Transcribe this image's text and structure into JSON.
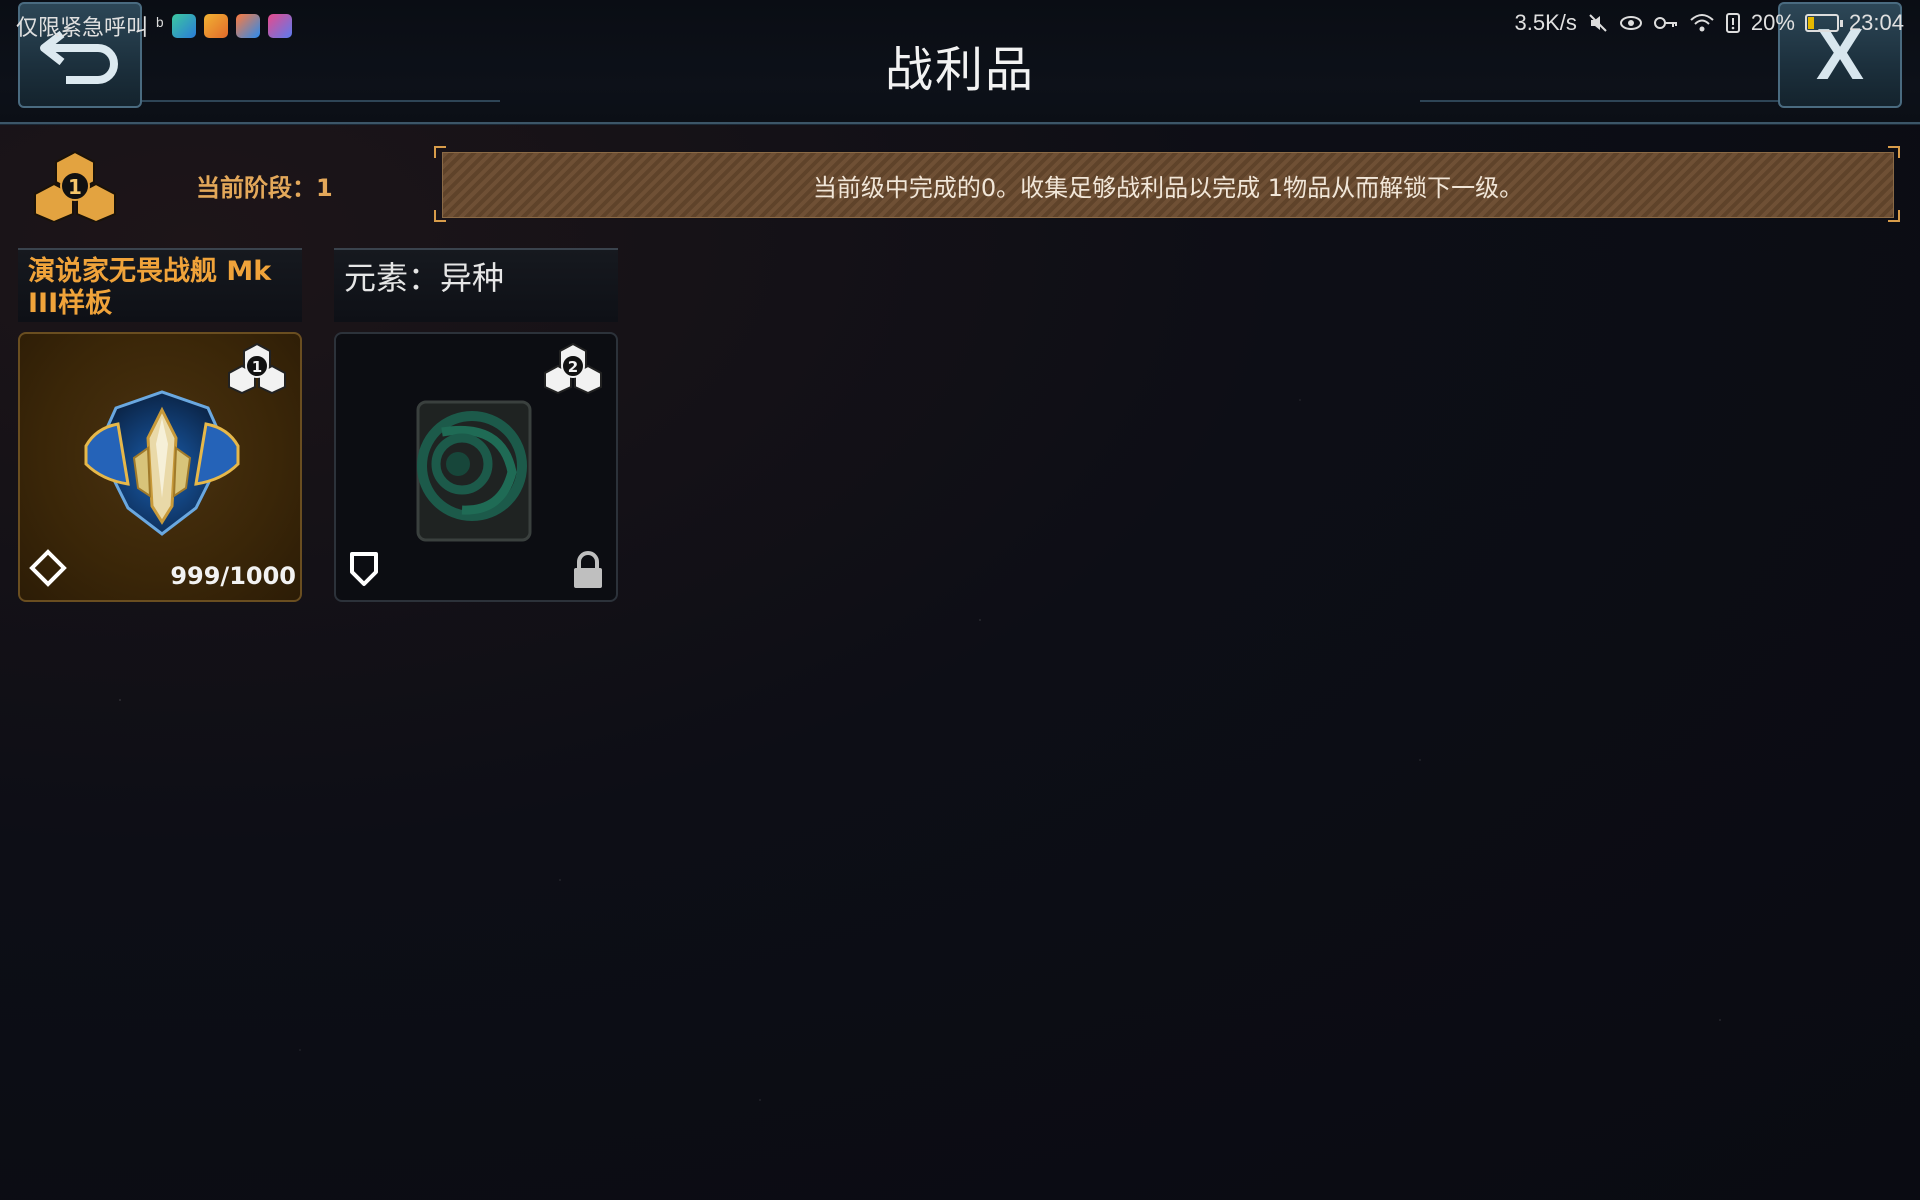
{
  "status_bar": {
    "carrier_text": "仅限紧急呼叫",
    "net_speed": "3.5K/s",
    "battery_percent": "20%",
    "battery_level": 0.2,
    "time": "23:04",
    "notification_icons": [
      "weibo-icon",
      "app-icon-green",
      "app-icon-orange",
      "app-icon-video",
      "app-icon-play"
    ],
    "system_icons": [
      "mute-icon",
      "eye-icon",
      "key-icon",
      "wifi-icon",
      "alert-icon",
      "battery-icon"
    ]
  },
  "header": {
    "title": "战利品",
    "back_icon": "back-arrow-icon",
    "close_label": "X"
  },
  "stage": {
    "icon": "tier-cubes-icon",
    "tier_number": "1",
    "label": "当前阶段：1"
  },
  "info": {
    "message": "当前级中完成的0。收集足够战利品以完成 1物品从而解锁下一级。"
  },
  "rewards": [
    {
      "title": "演说家无畏战舰 Mk III样板",
      "tier": "1",
      "art_icon": "dreadnought-ship-icon",
      "rarity_icon": "diamond-rarity-icon",
      "count": "999/1000",
      "locked": false,
      "highlight_color": "#f0a33a"
    },
    {
      "title": "元素：异种",
      "tier": "2",
      "art_icon": "xeno-element-icon",
      "rarity_icon": "shield-rarity-icon",
      "locked": true,
      "lock_icon": "lock-icon"
    }
  ]
}
